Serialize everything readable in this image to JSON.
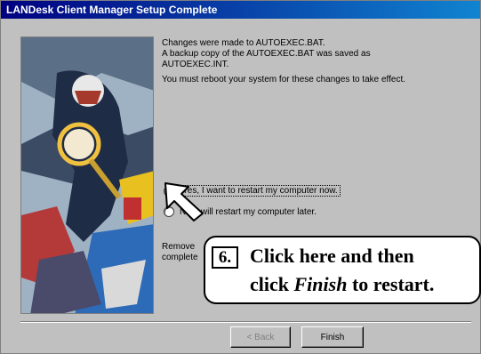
{
  "window": {
    "title": "LANDesk Client Manager Setup Complete"
  },
  "message": {
    "line1": "Changes were made to AUTOEXEC.BAT.",
    "line2": "A backup copy of the AUTOEXEC.BAT was saved as",
    "line3": "AUTOEXEC.INT.",
    "reboot": "You must reboot your system for these changes to take effect."
  },
  "options": {
    "restart_now": "Yes, I want to restart my computer now.",
    "restart_later": "No, I will restart my computer later.",
    "selected": "restart_now"
  },
  "remove_note": {
    "line1": "Remove",
    "line2": "complete"
  },
  "buttons": {
    "back": "< Back",
    "finish": "Finish"
  },
  "callout": {
    "number": "6.",
    "line1": "Click here and then",
    "line2_pre": "click ",
    "line2_em": "Finish",
    "line2_post": " to restart."
  },
  "colors": {
    "title_start": "#000080",
    "title_end": "#1084d0",
    "face": "#c0c0c0"
  }
}
